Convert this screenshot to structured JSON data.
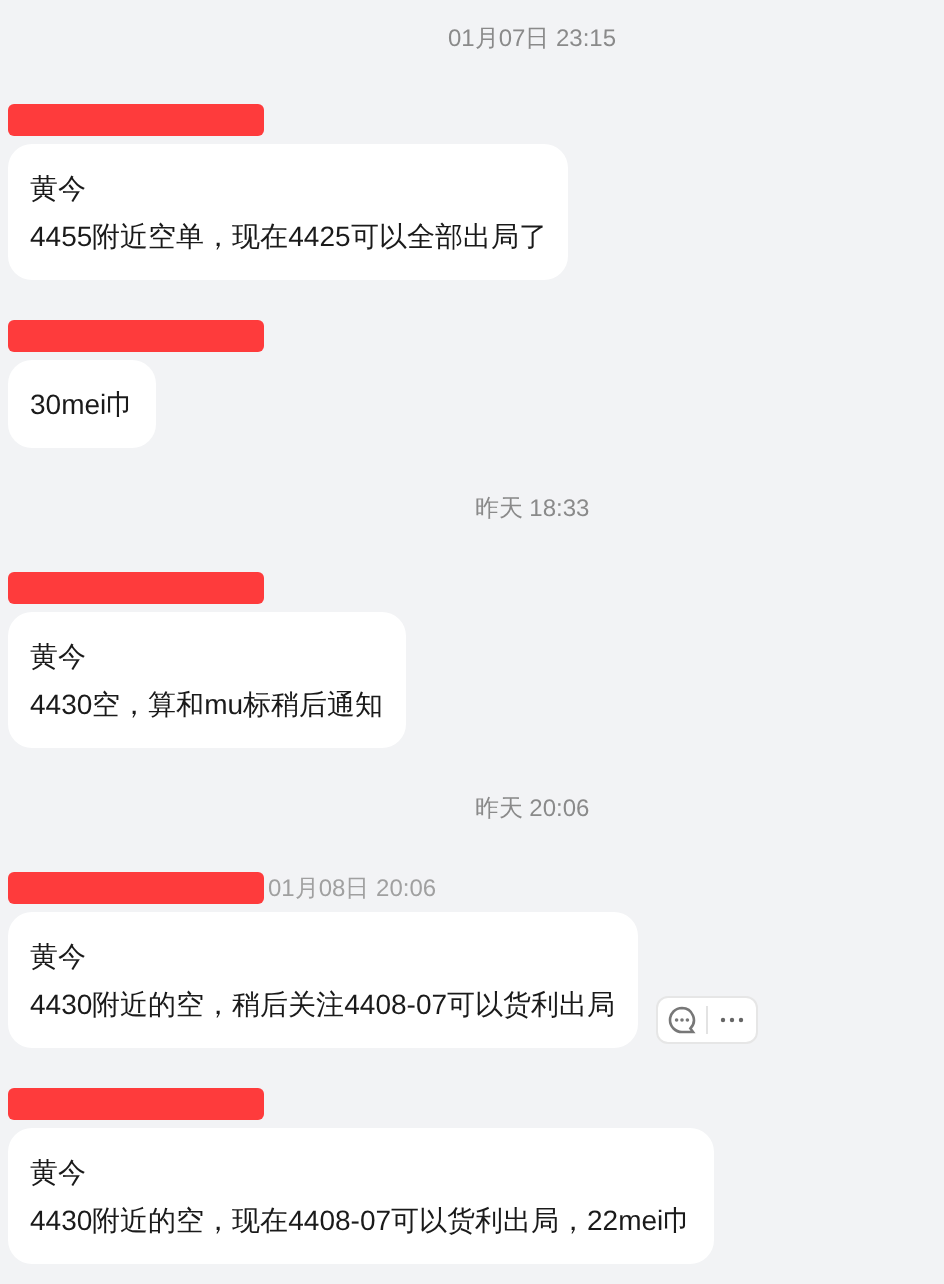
{
  "conversation": [
    {
      "kind": "time",
      "text": "01月07日 23:15"
    },
    {
      "kind": "message",
      "lines": [
        "黄今",
        "4455附近空单，现在4425可以全部出局了"
      ]
    },
    {
      "kind": "message",
      "lines": [
        "30mei巾"
      ]
    },
    {
      "kind": "time",
      "text": "昨天 18:33"
    },
    {
      "kind": "message",
      "lines": [
        "黄今",
        "4430空，算和mu标稍后通知"
      ]
    },
    {
      "kind": "time",
      "text": "昨天 20:06"
    },
    {
      "kind": "message",
      "time": "01月08日 20:06",
      "hovered": true,
      "lines": [
        "黄今",
        "4430附近的空，稍后关注4408-07可以货利出局"
      ]
    },
    {
      "kind": "message",
      "lines": [
        "黄今",
        "4430附近的空，现在4408-07可以货利出局，22mei巾"
      ]
    }
  ]
}
